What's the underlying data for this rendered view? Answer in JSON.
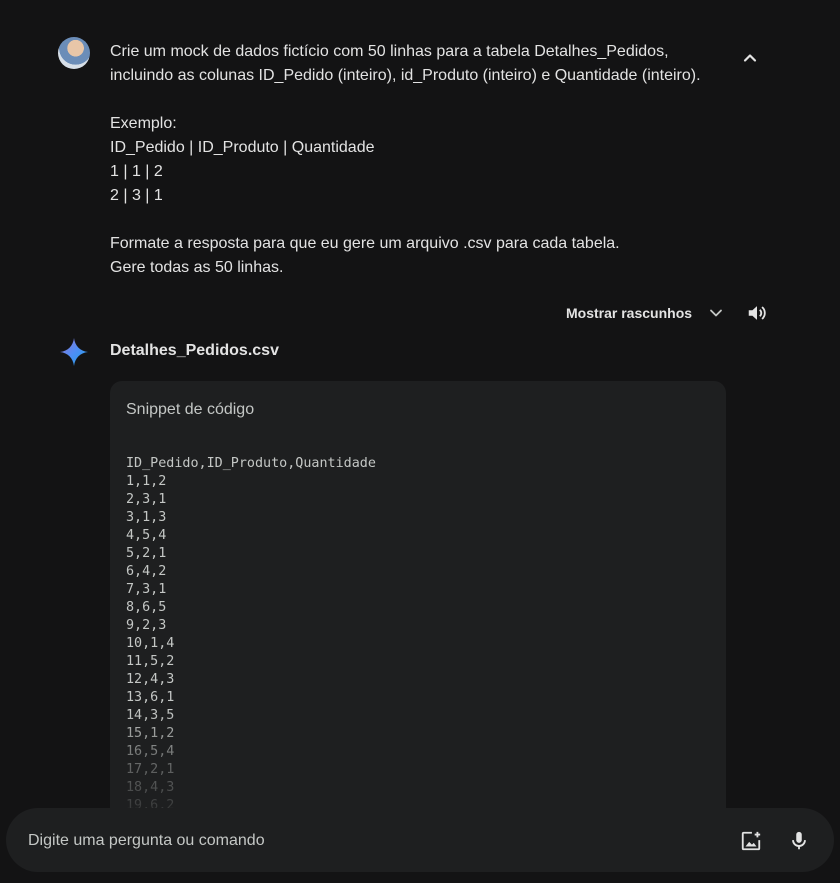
{
  "prompt": {
    "line1": "Crie um mock de dados fictício com 50 linhas para a tabela Detalhes_Pedidos,",
    "line2": "incluindo as colunas ID_Pedido (inteiro), id_Produto (inteiro) e Quantidade (inteiro).",
    "example_label": "Exemplo:",
    "example_header": "ID_Pedido | ID_Produto | Quantidade",
    "example_row1": "1 | 1 | 2",
    "example_row2": "2 | 3 | 1",
    "instruction1": "Formate a resposta para que eu gere um arquivo .csv para cada tabela.",
    "instruction2": "Gere todas as 50 linhas."
  },
  "drafts": {
    "label": "Mostrar rascunhos"
  },
  "response": {
    "title": "Detalhes_Pedidos.csv",
    "code_header": "Snippet de código",
    "code_lines": [
      "ID_Pedido,ID_Produto,Quantidade",
      "1,1,2",
      "2,3,1",
      "3,1,3",
      "4,5,4",
      "5,2,1",
      "6,4,2",
      "7,3,1",
      "8,6,5",
      "9,2,3",
      "10,1,4",
      "11,5,2",
      "12,4,3",
      "13,6,1",
      "14,3,5",
      "15,1,2",
      "16,5,4",
      "17,2,1",
      "18,4,3",
      "19,6,2"
    ]
  },
  "input": {
    "placeholder": "Digite uma pergunta ou comando"
  },
  "colors": {
    "background": "#131314",
    "card": "#1e1f20",
    "text": "#e3e3e3",
    "gemini_blue": "#4f8df5"
  }
}
